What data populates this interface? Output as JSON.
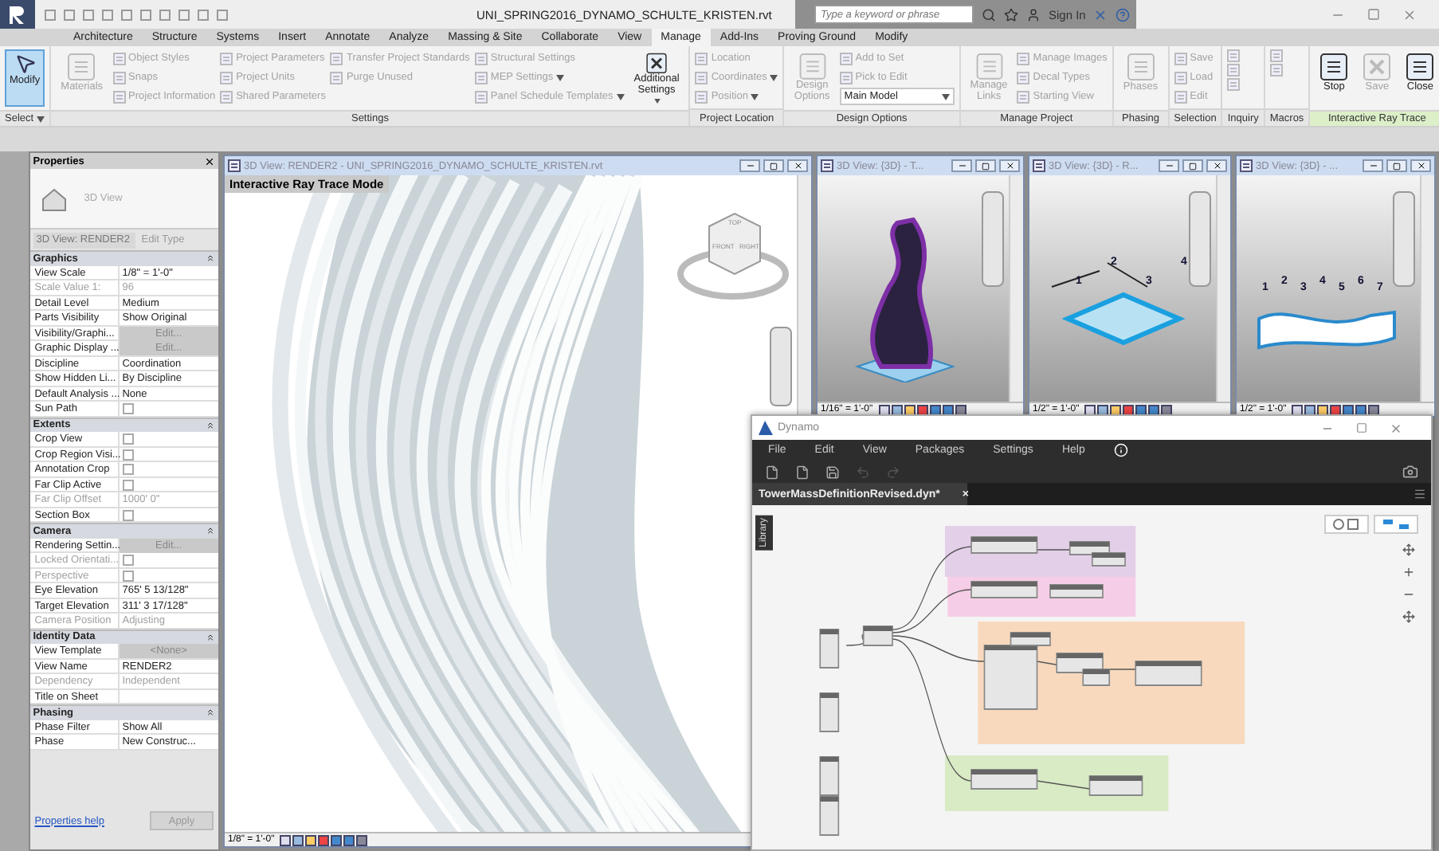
{
  "title_bar": {
    "file_title": "UNI_SPRING2016_DYNAMO_SCHULTE_KRISTEN.rvt",
    "search": {
      "placeholder": "Type a keyword or phrase"
    },
    "sign_in": "Sign In"
  },
  "ribbon_tabs": [
    {
      "label": "Architecture",
      "selected": false
    },
    {
      "label": "Structure",
      "selected": false
    },
    {
      "label": "Systems",
      "selected": false
    },
    {
      "label": "Insert",
      "selected": false
    },
    {
      "label": "Annotate",
      "selected": false
    },
    {
      "label": "Analyze",
      "selected": false
    },
    {
      "label": "Massing & Site",
      "selected": false
    },
    {
      "label": "Collaborate",
      "selected": false
    },
    {
      "label": "View",
      "selected": false
    },
    {
      "label": "Manage",
      "selected": true
    },
    {
      "label": "Add-Ins",
      "selected": false
    },
    {
      "label": "Proving Ground",
      "selected": false
    },
    {
      "label": "Modify",
      "selected": false
    }
  ],
  "ribbon_panels": [
    {
      "label": "Select",
      "has_menu": true,
      "highlighted": false,
      "columns": [
        [
          {
            "kind": "large",
            "label": "Modify",
            "disabled": false,
            "selected": true
          }
        ]
      ]
    },
    {
      "label": "Settings",
      "highlighted": false,
      "columns": [
        [
          {
            "kind": "large",
            "label": "Materials",
            "disabled": true,
            "selected": false
          }
        ],
        [
          {
            "kind": "small",
            "label": "Object Styles",
            "disabled": true,
            "selected": false
          },
          {
            "kind": "small",
            "label": "Snaps",
            "disabled": true,
            "selected": false
          },
          {
            "kind": "small",
            "label": "Project Information",
            "disabled": true,
            "selected": false
          }
        ],
        [
          {
            "kind": "small",
            "label": "Project Parameters",
            "disabled": true,
            "selected": false
          },
          {
            "kind": "small",
            "label": "Project Units",
            "disabled": true,
            "selected": false
          },
          {
            "kind": "small",
            "label": "Shared Parameters",
            "disabled": true,
            "selected": false
          }
        ],
        [
          {
            "kind": "small",
            "label": "Transfer Project Standards",
            "disabled": true,
            "selected": false
          },
          {
            "kind": "small",
            "label": "Purge Unused",
            "disabled": true,
            "selected": false
          }
        ],
        [
          {
            "kind": "small",
            "label": "Structural Settings",
            "disabled": true,
            "selected": false
          },
          {
            "kind": "small",
            "label": "MEP Settings",
            "disabled": true,
            "selected": false,
            "has_menu": true
          },
          {
            "kind": "small",
            "label": "Panel Schedule Templates",
            "disabled": true,
            "selected": false,
            "has_menu": true
          }
        ],
        [
          {
            "kind": "large",
            "label": "Additional Settings",
            "disabled": false,
            "selected": false,
            "has_menu": true
          }
        ]
      ]
    },
    {
      "label": "Project Location",
      "highlighted": false,
      "columns": [
        [
          {
            "kind": "small",
            "label": "Location",
            "disabled": true,
            "selected": false
          },
          {
            "kind": "small",
            "label": "Coordinates",
            "disabled": true,
            "selected": false,
            "has_menu": true
          },
          {
            "kind": "small",
            "label": "Position",
            "disabled": true,
            "selected": false,
            "has_menu": true
          }
        ]
      ]
    },
    {
      "label": "Design Options",
      "highlighted": false,
      "columns": [
        [
          {
            "kind": "large",
            "label": "Design Options",
            "disabled": true,
            "selected": false
          }
        ],
        [
          {
            "kind": "small",
            "label": "Add to Set",
            "disabled": true,
            "selected": false
          },
          {
            "kind": "small",
            "label": "Pick to Edit",
            "disabled": true,
            "selected": false
          },
          {
            "kind": "dropdown",
            "label": "Main Model",
            "disabled": false,
            "selected": false,
            "has_menu": true
          }
        ]
      ]
    },
    {
      "label": "Manage Project",
      "highlighted": false,
      "columns": [
        [
          {
            "kind": "large",
            "label": "Manage Links",
            "disabled": true,
            "selected": false
          }
        ],
        [
          {
            "kind": "small",
            "label": "Manage Images",
            "disabled": true,
            "selected": false
          },
          {
            "kind": "small",
            "label": "Decal Types",
            "disabled": true,
            "selected": false
          },
          {
            "kind": "small",
            "label": "Starting View",
            "disabled": true,
            "selected": false
          }
        ]
      ]
    },
    {
      "label": "Phasing",
      "highlighted": false,
      "columns": [
        [
          {
            "kind": "large",
            "label": "Phases",
            "disabled": true,
            "selected": false
          }
        ]
      ]
    },
    {
      "label": "Selection",
      "highlighted": false,
      "columns": [
        [
          {
            "kind": "small",
            "label": "Save",
            "disabled": true,
            "selected": false
          },
          {
            "kind": "small",
            "label": "Load",
            "disabled": true,
            "selected": false
          },
          {
            "kind": "small",
            "label": "Edit",
            "disabled": true,
            "selected": false
          }
        ]
      ]
    },
    {
      "label": "Inquiry",
      "highlighted": false,
      "columns": [
        [
          {
            "kind": "icon",
            "disabled": true,
            "selected": false
          },
          {
            "kind": "icon",
            "disabled": true,
            "selected": false
          },
          {
            "kind": "icon",
            "disabled": true,
            "selected": false
          }
        ]
      ]
    },
    {
      "label": "Macros",
      "highlighted": false,
      "columns": [
        [
          {
            "kind": "icon",
            "disabled": true,
            "selected": false
          },
          {
            "kind": "icon",
            "disabled": true,
            "selected": false
          }
        ]
      ]
    },
    {
      "label": "Interactive Ray Trace",
      "highlighted": true,
      "columns": [
        [
          {
            "kind": "large",
            "label": "Stop",
            "disabled": false,
            "selected": false
          }
        ],
        [
          {
            "kind": "large",
            "label": "Save",
            "disabled": true,
            "selected": false
          }
        ],
        [
          {
            "kind": "large",
            "label": "Close",
            "disabled": false,
            "selected": false
          }
        ]
      ]
    }
  ],
  "properties": {
    "title": "Properties",
    "type_name": "3D View",
    "instance": "3D View: RENDER2",
    "edit_type": "Edit Type",
    "sections": [
      {
        "title": "Graphics",
        "rows": [
          {
            "name": "View Scale",
            "kind": "text",
            "value": "1/8\" = 1'-0\"",
            "disabled": false
          },
          {
            "name": "Scale Value    1:",
            "kind": "text",
            "value": "96",
            "disabled": true
          },
          {
            "name": "Detail Level",
            "kind": "text",
            "value": "Medium",
            "disabled": false
          },
          {
            "name": "Parts Visibility",
            "kind": "text",
            "value": "Show Original",
            "disabled": false
          },
          {
            "name": "Visibility/Graphi...",
            "kind": "button",
            "value": "Edit...",
            "disabled": false
          },
          {
            "name": "Graphic Display ...",
            "kind": "button",
            "value": "Edit...",
            "disabled": false
          },
          {
            "name": "Discipline",
            "kind": "text",
            "value": "Coordination",
            "disabled": false
          },
          {
            "name": "Show Hidden Li...",
            "kind": "text",
            "value": "By Discipline",
            "disabled": false
          },
          {
            "name": "Default Analysis ...",
            "kind": "text",
            "value": "None",
            "disabled": false
          },
          {
            "name": "Sun Path",
            "kind": "check",
            "checked": false,
            "disabled": false
          }
        ]
      },
      {
        "title": "Extents",
        "rows": [
          {
            "name": "Crop View",
            "kind": "check",
            "checked": false,
            "disabled": false
          },
          {
            "name": "Crop Region Visi...",
            "kind": "check",
            "checked": false,
            "disabled": false
          },
          {
            "name": "Annotation Crop",
            "kind": "check",
            "checked": false,
            "disabled": false
          },
          {
            "name": "Far Clip Active",
            "kind": "check",
            "checked": false,
            "disabled": false
          },
          {
            "name": "Far Clip Offset",
            "kind": "text",
            "value": "1000'  0\"",
            "disabled": true
          },
          {
            "name": "Section Box",
            "kind": "check",
            "checked": false,
            "disabled": false
          }
        ]
      },
      {
        "title": "Camera",
        "rows": [
          {
            "name": "Rendering Settin...",
            "kind": "button",
            "value": "Edit...",
            "disabled": false
          },
          {
            "name": "Locked Orientati...",
            "kind": "check",
            "checked": false,
            "disabled": true
          },
          {
            "name": "Perspective",
            "kind": "check",
            "checked": false,
            "disabled": true
          },
          {
            "name": "Eye Elevation",
            "kind": "text",
            "value": "765'  5 13/128\"",
            "disabled": false
          },
          {
            "name": "Target Elevation",
            "kind": "text",
            "value": "311'  3 17/128\"",
            "disabled": false
          },
          {
            "name": "Camera Position",
            "kind": "text",
            "value": "Adjusting",
            "disabled": true
          }
        ]
      },
      {
        "title": "Identity Data",
        "rows": [
          {
            "name": "View Template",
            "kind": "button",
            "value": "<None>",
            "disabled": false
          },
          {
            "name": "View Name",
            "kind": "text",
            "value": "RENDER2",
            "disabled": false
          },
          {
            "name": "Dependency",
            "kind": "text",
            "value": "Independent",
            "disabled": true
          },
          {
            "name": "Title on Sheet",
            "kind": "text",
            "disabled": false
          }
        ]
      },
      {
        "title": "Phasing",
        "rows": [
          {
            "name": "Phase Filter",
            "kind": "text",
            "value": "Show All",
            "disabled": false
          },
          {
            "name": "Phase",
            "kind": "text",
            "value": "New Construc...",
            "disabled": false
          }
        ]
      }
    ],
    "help_link": "Properties help",
    "apply": "Apply"
  },
  "render_view": {
    "title": "3D View: RENDER2 - UNI_SPRING2016_DYNAMO_SCHULTE_KRISTEN.rvt",
    "mode_label": "Interactive Ray Trace Mode",
    "view_cube": [
      "TOP",
      "FRONT",
      "RIGHT"
    ],
    "scale": "1/8\" = 1'-0\""
  },
  "small_views": [
    {
      "title": "3D View: {3D} - T...",
      "scale": "1/16\" = 1'-0\"",
      "kind": "tower"
    },
    {
      "title": "3D View: {3D} - R...",
      "scale": "1/2\" = 1'-0\"",
      "kind": "frame",
      "markers": [
        "1",
        "2",
        "3",
        "4"
      ]
    },
    {
      "title": "3D View: {3D} - ...",
      "scale": "1/2\" = 1'-0\"",
      "kind": "ribbon",
      "markers": [
        "1",
        "2",
        "3",
        "4",
        "5",
        "6",
        "7"
      ]
    }
  ],
  "dynamo": {
    "title": "Dynamo",
    "menu": [
      "File",
      "Edit",
      "View",
      "Packages",
      "Settings",
      "Help"
    ],
    "tab": {
      "label": "TowerMassDefinitionRevised.dyn*",
      "close": "×"
    },
    "library": "Library"
  }
}
